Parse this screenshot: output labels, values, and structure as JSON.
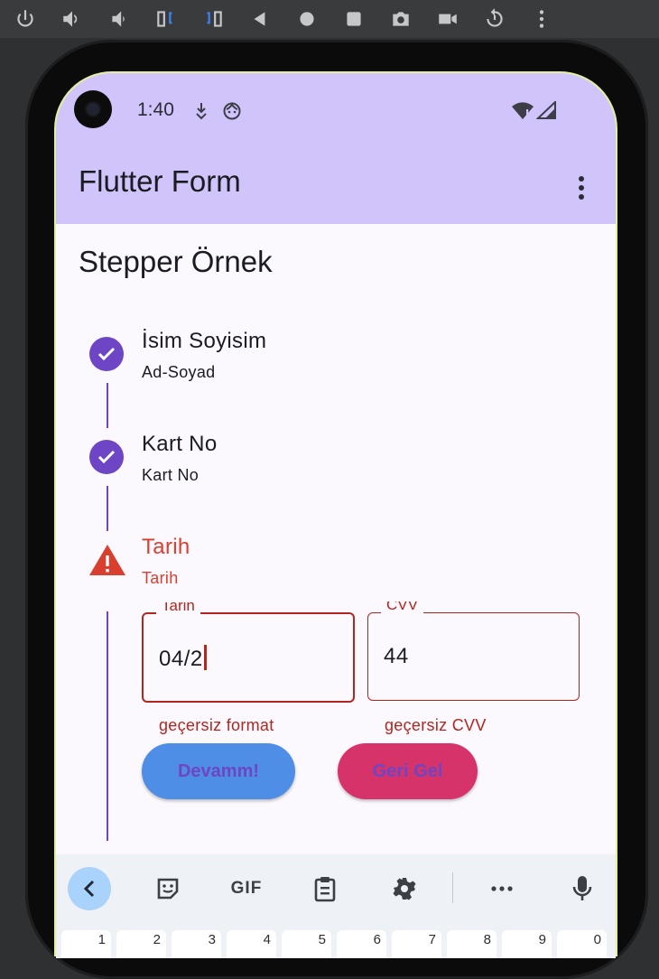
{
  "colors": {
    "appbar": "#d0c4fa",
    "step_active": "#6e45c4",
    "error": "#b3261e",
    "warning": "#d93f2f",
    "continue_button": "#4f8ee6",
    "back_button": "#d5336a"
  },
  "emulator_toolbar": {
    "icons": [
      "power-icon",
      "volume-up-icon",
      "volume-down-icon",
      "rotate-left-icon",
      "rotate-right-icon",
      "back-icon",
      "home-icon",
      "overview-icon",
      "camera-icon",
      "video-icon",
      "replay-icon",
      "more-vert-icon"
    ]
  },
  "status_bar": {
    "time": "1:40",
    "icons": [
      "download-icon",
      "face-icon",
      "wifi-icon",
      "signal-icon"
    ]
  },
  "app_bar": {
    "title": "Flutter Form"
  },
  "page": {
    "title": "Stepper Örnek"
  },
  "steps": [
    {
      "title": "İsim Soyisim",
      "subtitle": "Ad-Soyad",
      "state": "complete"
    },
    {
      "title": "Kart No",
      "subtitle": "Kart No",
      "state": "complete"
    },
    {
      "title": "Tarih",
      "subtitle": "Tarih",
      "state": "error"
    }
  ],
  "form": {
    "date_field": {
      "label": "Tarih",
      "value": "04/2",
      "error": "geçersiz format"
    },
    "cvv_field": {
      "label": "CVV",
      "value": "44",
      "error": "geçersiz CVV"
    },
    "continue_label": "Devamm!",
    "back_label": "Geri Gel"
  },
  "keyboard": {
    "toolbar_icons": [
      "chevron-left-icon",
      "sticker-icon",
      "gif-icon",
      "clipboard-icon",
      "gear-icon",
      "more-horiz-icon",
      "mic-icon"
    ],
    "gif_label": "GIF",
    "number_row": [
      "1",
      "2",
      "3",
      "4",
      "5",
      "6",
      "7",
      "8",
      "9",
      "0"
    ]
  }
}
